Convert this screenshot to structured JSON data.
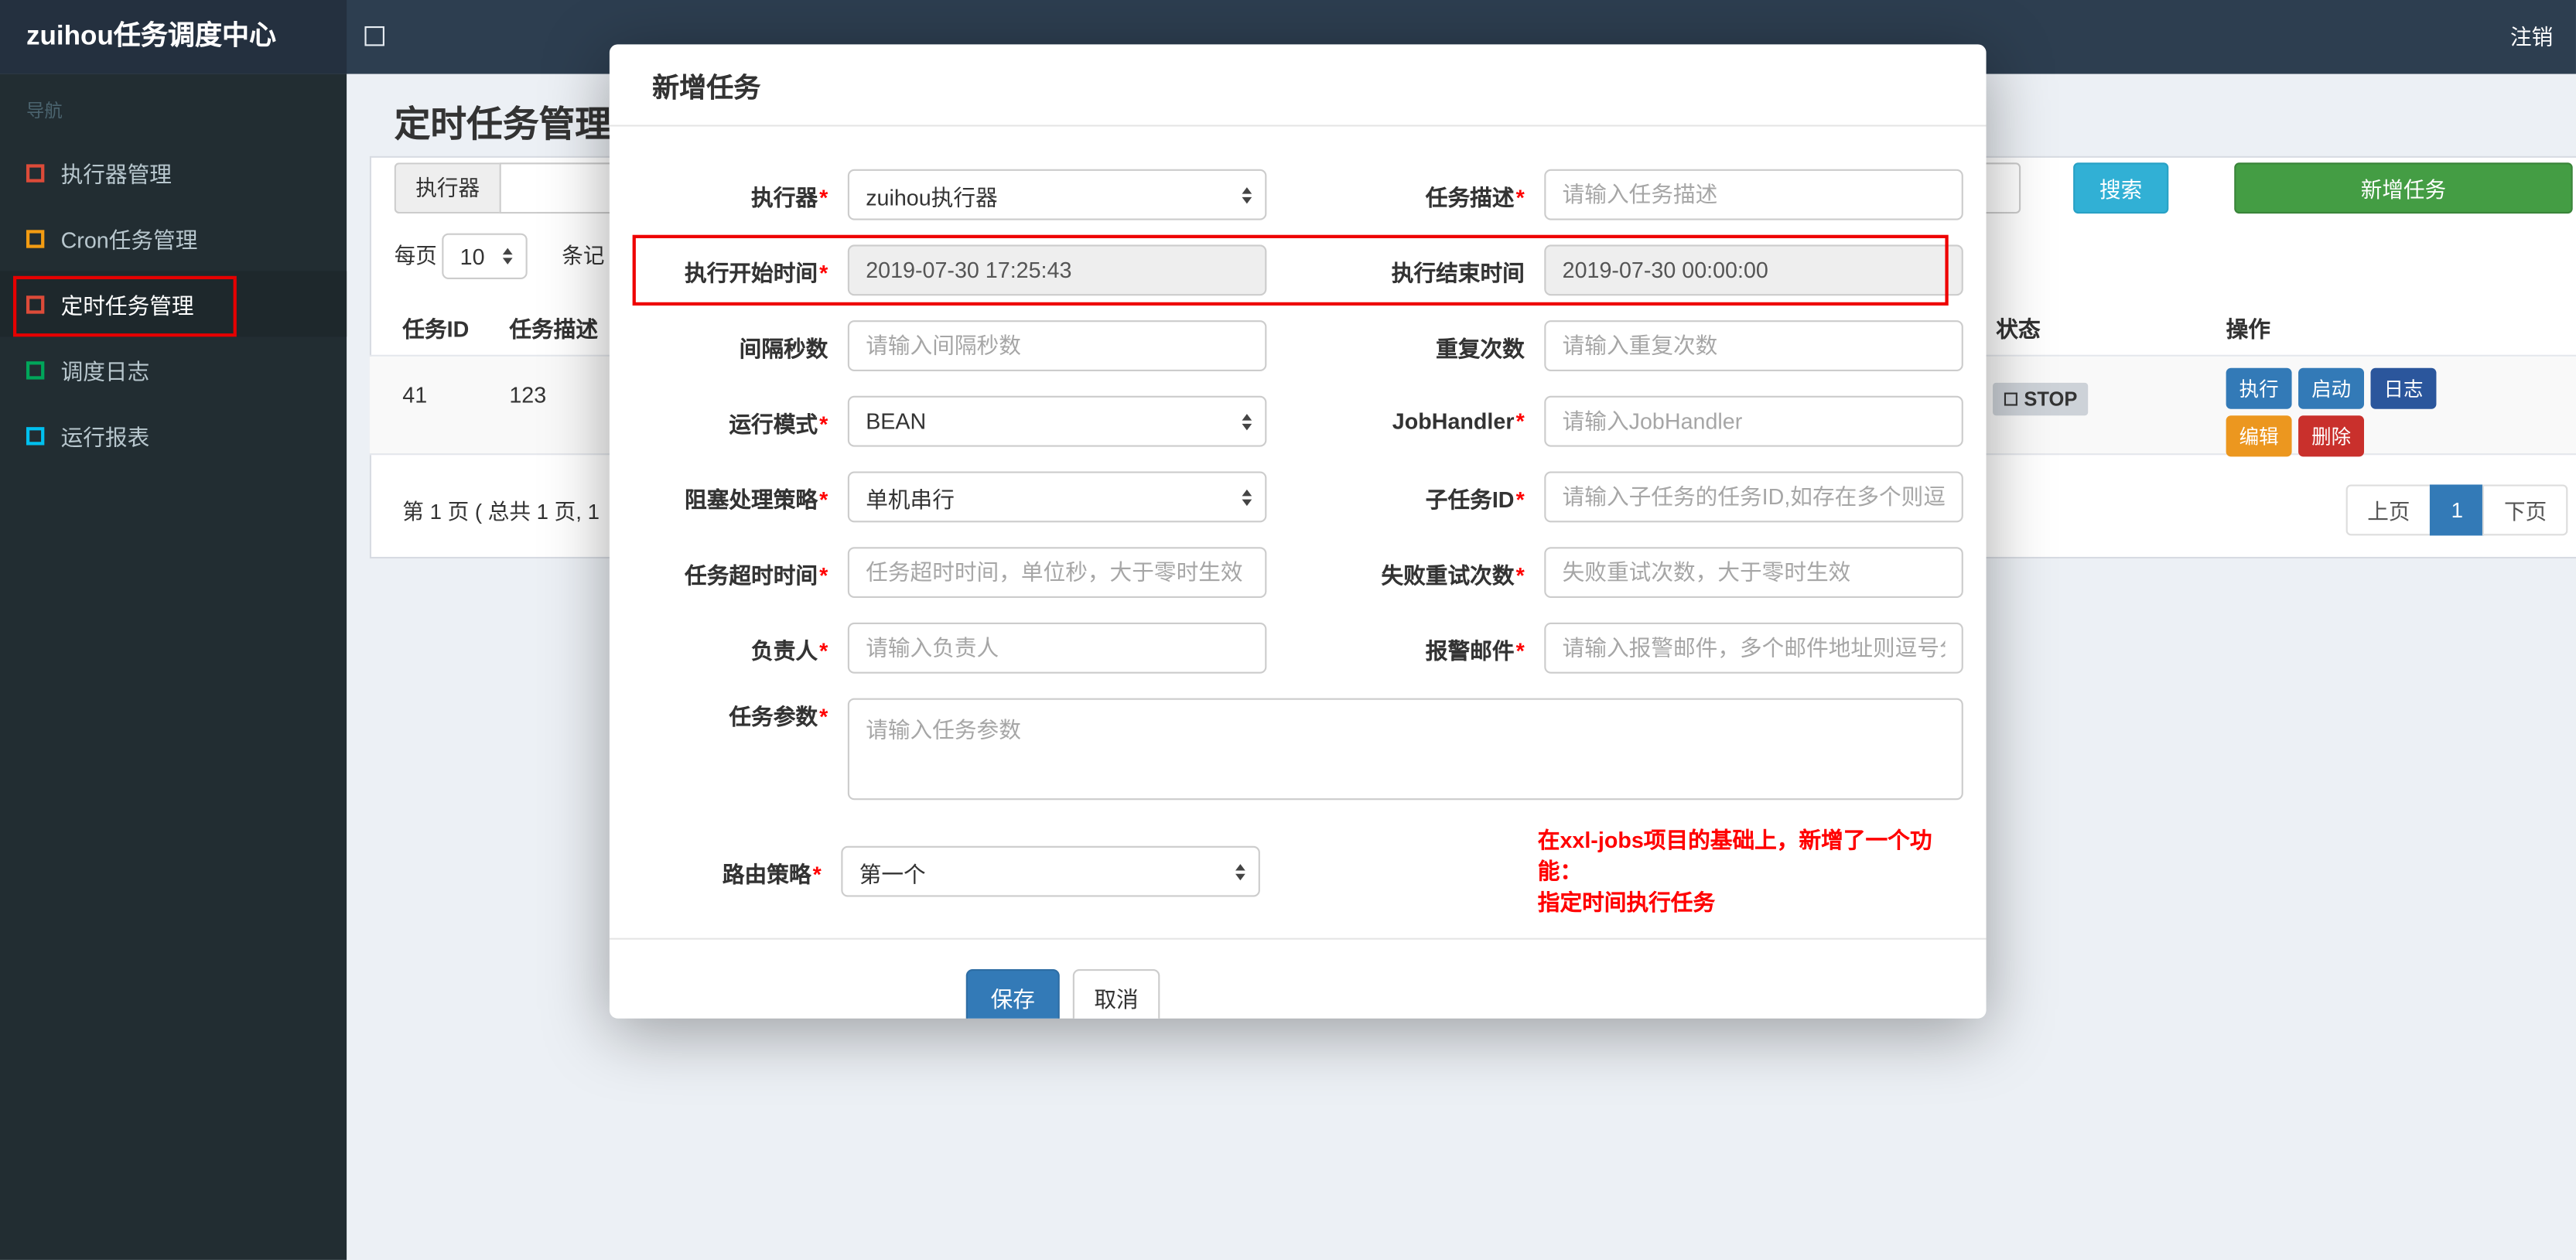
{
  "navbar": {
    "brand": "zuihou任务调度中心",
    "logout": "注销"
  },
  "sidebar": {
    "section_label": "导航",
    "items": [
      {
        "id": "executor-manage",
        "label": "执行器管理",
        "icon": "square-red-icon",
        "icon_color": "#dd4b39"
      },
      {
        "id": "cron-task-manage",
        "label": "Cron任务管理",
        "icon": "square-orange-icon",
        "icon_color": "#f39c12"
      },
      {
        "id": "timed-task-manage",
        "label": "定时任务管理",
        "icon": "square-red-icon",
        "icon_color": "#dd4b39",
        "active": true
      },
      {
        "id": "schedule-log",
        "label": "调度日志",
        "icon": "square-green-icon",
        "icon_color": "#00a65a"
      },
      {
        "id": "run-report",
        "label": "运行报表",
        "icon": "square-cyan-icon",
        "icon_color": "#00c0ef"
      }
    ]
  },
  "page": {
    "title": "定时任务管理",
    "filter": {
      "executor_addon": "执行器",
      "executor_value": "",
      "search_button": "搜索",
      "add_button": "新增任务",
      "search_color": "#31b0d5",
      "add_color": "#449d44"
    },
    "per_page": {
      "label_before": "每页",
      "value": "10",
      "label_after": "条记"
    },
    "table": {
      "headers": [
        "任务ID",
        "任务描述",
        "状态",
        "操作"
      ],
      "row": {
        "id": "41",
        "desc": "123",
        "status": "STOP",
        "ops": [
          [
            {
              "label": "执行",
              "color": "#337ab7",
              "name": "run-button"
            },
            {
              "label": "启动",
              "color": "#337ab7",
              "name": "start-button"
            },
            {
              "label": "日志",
              "color": "#2b569c",
              "name": "log-button"
            }
          ],
          [
            {
              "label": "编辑",
              "color": "#ec971f",
              "name": "edit-button"
            },
            {
              "label": "删除",
              "color": "#c9302c",
              "name": "delete-button"
            }
          ]
        ]
      }
    },
    "pagination": {
      "info": "第 1 页 ( 总共 1 页, 1",
      "prev": "上页",
      "current": "1",
      "next": "下页"
    }
  },
  "modal": {
    "title": "新增任务",
    "highlight_color": "#ee0000",
    "form_rows": [
      {
        "left": {
          "label": "执行器",
          "required": true,
          "kind": "select",
          "value": "zuihou执行器",
          "name": "executor-select"
        },
        "right": {
          "label": "任务描述",
          "required": true,
          "kind": "input",
          "placeholder": "请输入任务描述",
          "name": "job-desc-input"
        }
      },
      {
        "highlight": true,
        "left": {
          "label": "执行开始时间",
          "required": true,
          "kind": "readonly",
          "value": "2019-07-30 17:25:43",
          "name": "start-time-input"
        },
        "right": {
          "label": "执行结束时间",
          "required": false,
          "kind": "readonly",
          "value": "2019-07-30 00:00:00",
          "name": "end-time-input"
        }
      },
      {
        "left": {
          "label": "间隔秒数",
          "required": false,
          "kind": "input",
          "placeholder": "请输入间隔秒数",
          "name": "interval-seconds-input"
        },
        "right": {
          "label": "重复次数",
          "required": false,
          "kind": "input",
          "placeholder": "请输入重复次数",
          "name": "repeat-count-input"
        }
      },
      {
        "left": {
          "label": "运行模式",
          "required": true,
          "kind": "select",
          "value": "BEAN",
          "name": "run-mode-select"
        },
        "right": {
          "label": "JobHandler",
          "required": true,
          "kind": "input",
          "placeholder": "请输入JobHandler",
          "name": "jobhandler-input"
        }
      },
      {
        "left": {
          "label": "阻塞处理策略",
          "required": true,
          "kind": "select",
          "value": "单机串行",
          "name": "block-strategy-select"
        },
        "right": {
          "label": "子任务ID",
          "required": true,
          "kind": "input",
          "placeholder": "请输入子任务的任务ID,如存在多个则逗",
          "name": "child-job-id-input"
        }
      },
      {
        "left": {
          "label": "任务超时时间",
          "required": true,
          "kind": "input",
          "placeholder": "任务超时时间，单位秒，大于零时生效",
          "name": "timeout-input"
        },
        "right": {
          "label": "失败重试次数",
          "required": true,
          "kind": "input",
          "placeholder": "失败重试次数，大于零时生效",
          "name": "fail-retry-input"
        }
      },
      {
        "left": {
          "label": "负责人",
          "required": true,
          "kind": "input",
          "placeholder": "请输入负责人",
          "name": "author-input"
        },
        "right": {
          "label": "报警邮件",
          "required": true,
          "kind": "input",
          "placeholder": "请输入报警邮件，多个邮件地址则逗号分",
          "name": "alarm-email-input"
        }
      }
    ],
    "textarea_row": {
      "label": "任务参数",
      "required": true,
      "placeholder": "请输入任务参数",
      "name": "job-param-textarea"
    },
    "route_row": {
      "label": "路由策略",
      "required": true,
      "value": "第一个",
      "name": "route-strategy-select",
      "note_lines": [
        "在xxl-jobs项目的基础上，新增了一个功能：",
        "指定时间执行任务"
      ],
      "note_color": "#ff0000"
    },
    "save_button": "保存",
    "cancel_button": "取消"
  },
  "annotations": {
    "sidebar_box_color": "#e60000",
    "modal_box_color": "#ee0000"
  }
}
